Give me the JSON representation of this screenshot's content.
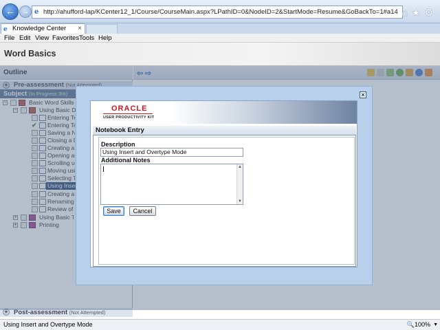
{
  "browser": {
    "url": "http://ahufford-lap/KCenter12_1/Course/CourseMain.aspx?LPathID=0&NodeID=2&StartMode=Resume&GoBackTo=1#a14",
    "tab_title": "Knowledge Center",
    "menu": [
      "File",
      "Edit",
      "View",
      "Favorites",
      "Tools",
      "Help"
    ],
    "status_text": "Using Insert and Overtype Mode",
    "zoom": "100%"
  },
  "app": {
    "title": "Word Basics"
  },
  "outline": {
    "header": "Outline",
    "pre_assessment": {
      "label": "Pre-assessment",
      "status": "(Not Attempted)"
    },
    "subject": {
      "label": "Subject",
      "status": "(In Progress 3%)"
    },
    "post_assessment": {
      "label": "Post-assessment",
      "status": "(Not Attempted)"
    },
    "tree": [
      {
        "label": "Basic Word Skills"
      },
      {
        "label": "Using Basic Documents"
      },
      {
        "label": "Entering Text"
      },
      {
        "label": "Entering Text"
      },
      {
        "label": "Saving a New Document"
      },
      {
        "label": "Closing a Document"
      },
      {
        "label": "Creating a New Document"
      },
      {
        "label": "Opening an Existing Document"
      },
      {
        "label": "Scrolling using the Mouse"
      },
      {
        "label": "Moving using the Keyboard"
      },
      {
        "label": "Selecting Text"
      },
      {
        "label": "Using Insert and Overtype Mode"
      },
      {
        "label": "Creating a New Folder"
      },
      {
        "label": "Renaming a File"
      },
      {
        "label": "Review of Basic Skills"
      },
      {
        "label": "Using Basic Text"
      },
      {
        "label": "Printing"
      }
    ]
  },
  "modal": {
    "close_glyph": "×",
    "brand": "ORACLE",
    "brand_sub": "USER PRODUCTIVITY KIT",
    "panel_title": "Notebook Entry",
    "description_label": "Description",
    "description_value": "Using Insert and Overtype Mode",
    "notes_label": "Additional Notes",
    "notes_value": "",
    "save_label": "Save",
    "cancel_label": "Cancel"
  },
  "colors": {
    "accent": "#2e4d7b",
    "oracle_red": "#d2141e",
    "modal_frame": "#b8d0ec"
  }
}
